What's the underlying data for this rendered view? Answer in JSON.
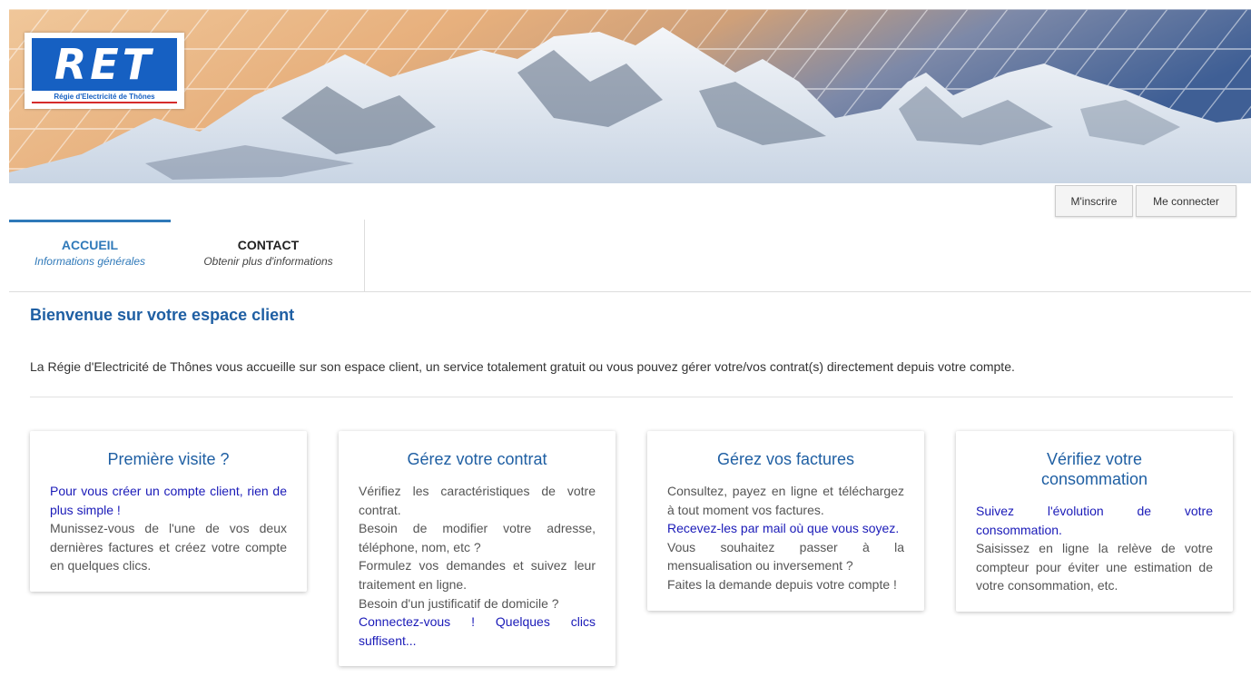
{
  "logo": {
    "mark": "RET",
    "subtitle": "Régie d'Electricité de Thônes"
  },
  "auth": {
    "register_label": "M'inscrire",
    "login_label": "Me connecter"
  },
  "nav": {
    "tabs": [
      {
        "title": "ACCUEIL",
        "subtitle": "Informations générales"
      },
      {
        "title": "CONTACT",
        "subtitle": "Obtenir plus d'informations"
      }
    ]
  },
  "main": {
    "title": "Bienvenue sur votre espace client",
    "intro": "La Régie d'Electricité de Thônes vous accueille sur son espace client, un service totalement gratuit ou vous pouvez gérer votre/vos contrat(s) directement depuis votre compte."
  },
  "cards": [
    {
      "title": "Première visite ?",
      "lines": [
        "Pour vous créer un compte client, rien de plus simple !",
        "Munissez-vous de l'une de vos deux dernières factures et créez votre compte en quelques clics."
      ]
    },
    {
      "title": "Gérez votre contrat",
      "lines": [
        "Vérifiez les caractéristiques de votre contrat.",
        "Besoin de modifier votre adresse, téléphone, nom, etc ?",
        "Formulez vos demandes et suivez leur traitement en ligne.",
        "Besoin d'un justificatif de domicile ?",
        "Connectez-vous ! Quelques clics suffisent..."
      ]
    },
    {
      "title": "Gérez vos factures",
      "lines": [
        "Consultez, payez en ligne et téléchargez à tout moment vos factures.",
        "Recevez-les par mail où que vous soyez.",
        "Vous souhaitez passer à la mensualisation ou inversement ?",
        "Faites la demande depuis votre compte !"
      ]
    },
    {
      "title": "Vérifiez votre consommation",
      "lines": [
        "Suivez l'évolution de votre consommation.",
        "Saisissez en ligne la relève de votre compteur pour éviter une estimation de votre consommation, etc."
      ]
    }
  ],
  "colors": {
    "brand_blue": "#1660c2",
    "heading_blue": "#1f5fa3",
    "highlight_text": "#1a1ab8",
    "body_text": "#555555"
  }
}
